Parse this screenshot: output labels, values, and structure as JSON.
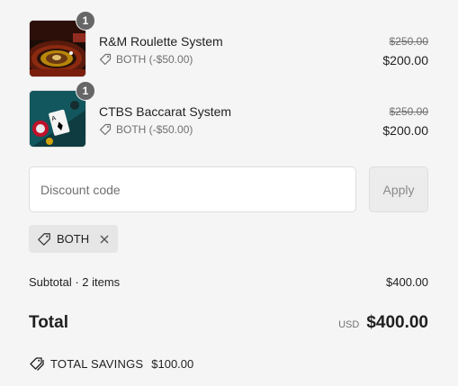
{
  "line_items": [
    {
      "name": "R&M Roulette System",
      "quantity": "1",
      "discount_label": "BOTH (-$50.00)",
      "original_price": "$250.00",
      "price": "$200.00",
      "thumbnail": "roulette-wheel"
    },
    {
      "name": "CTBS Baccarat System",
      "quantity": "1",
      "discount_label": "BOTH (-$50.00)",
      "original_price": "$250.00",
      "price": "$200.00",
      "thumbnail": "baccarat-table"
    }
  ],
  "discount": {
    "placeholder": "Discount code",
    "value": "",
    "apply_label": "Apply",
    "applied_code": "BOTH"
  },
  "summary": {
    "subtotal_label": "Subtotal · 2 items",
    "subtotal_value": "$400.00",
    "total_label": "Total",
    "currency": "USD",
    "total_value": "$400.00",
    "savings_label": "TOTAL SAVINGS",
    "savings_value": "$100.00"
  },
  "colors": {
    "background": "#f5f5f5",
    "text": "#1f1f1f",
    "muted": "#707070",
    "badge": "#666666"
  },
  "icons": [
    "tag-icon",
    "close-icon",
    "savings-tags-icon"
  ]
}
